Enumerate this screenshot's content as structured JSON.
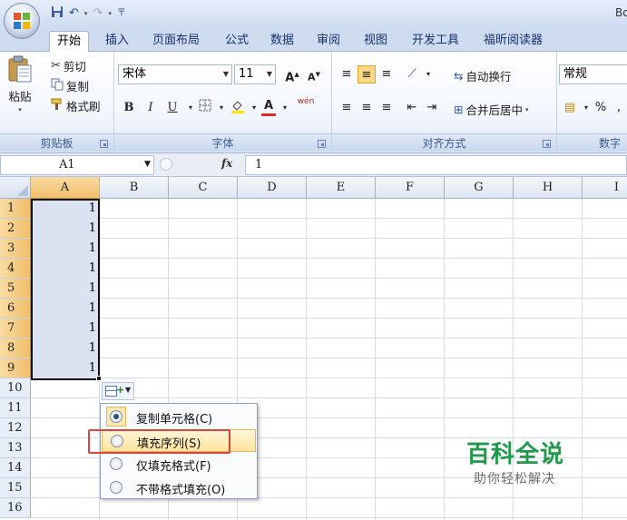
{
  "window": {
    "title": "Bo"
  },
  "tabs": [
    "开始",
    "插入",
    "页面布局",
    "公式",
    "数据",
    "审阅",
    "视图",
    "开发工具",
    "福昕阅读器"
  ],
  "ribbon": {
    "clipboard": {
      "label": "剪贴板",
      "paste": "粘贴",
      "cut": "剪切",
      "copy": "复制",
      "format_painter": "格式刷"
    },
    "font": {
      "label": "字体",
      "font_name": "宋体",
      "font_size": "11",
      "bold": "B",
      "italic": "I",
      "underline": "U",
      "grow": "A",
      "shrink": "A",
      "font_color_glyph": "A",
      "phonetic": "wén"
    },
    "alignment": {
      "label": "对齐方式",
      "wrap_text": "自动换行",
      "merge_center": "合并后居中"
    },
    "number": {
      "label": "数字",
      "format": "常规",
      "percent": "%"
    }
  },
  "formula_bar": {
    "name_box": "A1",
    "fx": "fx",
    "value": "1"
  },
  "sheet": {
    "columns": [
      "A",
      "B",
      "C",
      "D",
      "E",
      "F",
      "G",
      "H",
      "I"
    ],
    "rows": [
      "1",
      "2",
      "3",
      "4",
      "5",
      "6",
      "7",
      "8",
      "9",
      "10",
      "11",
      "12",
      "13",
      "14",
      "15",
      "16"
    ],
    "a_values": [
      "1",
      "1",
      "1",
      "1",
      "1",
      "1",
      "1",
      "1",
      "1"
    ],
    "selection": "A1:A9"
  },
  "autofill_menu": {
    "items": [
      {
        "label": "复制单元格(C)",
        "checked": true
      },
      {
        "label": "填充序列(S)",
        "checked": false
      },
      {
        "label": "仅填充格式(F)",
        "checked": false
      },
      {
        "label": "不带格式填充(O)",
        "checked": false
      }
    ],
    "highlighted_item": "填充序列(S)"
  },
  "watermark": {
    "title": "百科全说",
    "subtitle": "助你轻松解决"
  },
  "colors": {
    "selection_fill": "#dbe3f1",
    "header_selected": "#f2be6b",
    "red_outline": "#d9443c",
    "watermark_green": "#1e9a4a"
  }
}
